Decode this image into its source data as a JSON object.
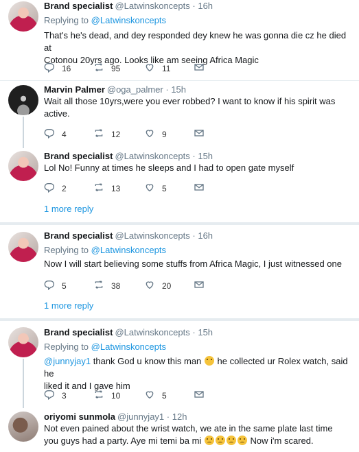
{
  "tweets": [
    {
      "author": "Brand specialist",
      "handle": "@Latwinskoncepts",
      "dot": "·",
      "time": "16h",
      "replying_prefix": "Replying to",
      "replying_to": "@Latwinskoncepts",
      "text_lines": [
        "That's he's dead, and dey responded dey knew he was gonna die cz he died at",
        "Cotonou 20yrs ago. Looks like am seeing Africa Magic"
      ],
      "replies": "16",
      "retweets": "95",
      "likes": "11"
    },
    {
      "author": "Marvin Palmer",
      "handle": "@oga_palmer",
      "dot": "·",
      "time": "15h",
      "text_lines": [
        "Wait all those 10yrs,were you ever robbed? I want to know if his spirit was",
        "active."
      ],
      "replies": "4",
      "retweets": "12",
      "likes": "9"
    },
    {
      "author": "Brand specialist",
      "handle": "@Latwinskoncepts",
      "dot": "·",
      "time": "15h",
      "text_lines": [
        "Lol No! Funny at times he sleeps and I had to open gate myself"
      ],
      "replies": "2",
      "retweets": "13",
      "likes": "5",
      "more_replies": "1 more reply"
    },
    {
      "author": "Brand specialist",
      "handle": "@Latwinskoncepts",
      "dot": "·",
      "time": "16h",
      "replying_prefix": "Replying to",
      "replying_to": "@Latwinskoncepts",
      "text_lines": [
        "Now I will start believing some stuffs from Africa Magic, I just witnessed one"
      ],
      "replies": "5",
      "retweets": "38",
      "likes": "20",
      "more_replies": "1 more reply"
    },
    {
      "author": "Brand specialist",
      "handle": "@Latwinskoncepts",
      "dot": "·",
      "time": "15h",
      "replying_prefix": "Replying to",
      "replying_to": "@Latwinskoncepts",
      "mention": "@junnyjay1",
      "text_a": "thank God u know this man",
      "text_b": "he collected ur Rolex watch, said he",
      "text_line2": "liked it and I gave him",
      "replies": "3",
      "retweets": "10",
      "likes": "5"
    },
    {
      "author": "oriyomi sunmola",
      "handle": "@junnyjay1",
      "dot": "·",
      "time": "12h",
      "text_lines": [
        "Not even pained about the wrist watch, we ate in the same plate last time"
      ],
      "text_line2a": "you guys had a party. Aye mi temi ba mi",
      "text_line2b": "Now i'm scared."
    }
  ],
  "icons": {
    "reply": "reply-icon",
    "retweet": "retweet-icon",
    "like": "heart-icon",
    "dm": "envelope-icon"
  },
  "colors": {
    "link": "#1b95e0",
    "muted": "#657786",
    "divider": "#e6ecf0"
  }
}
